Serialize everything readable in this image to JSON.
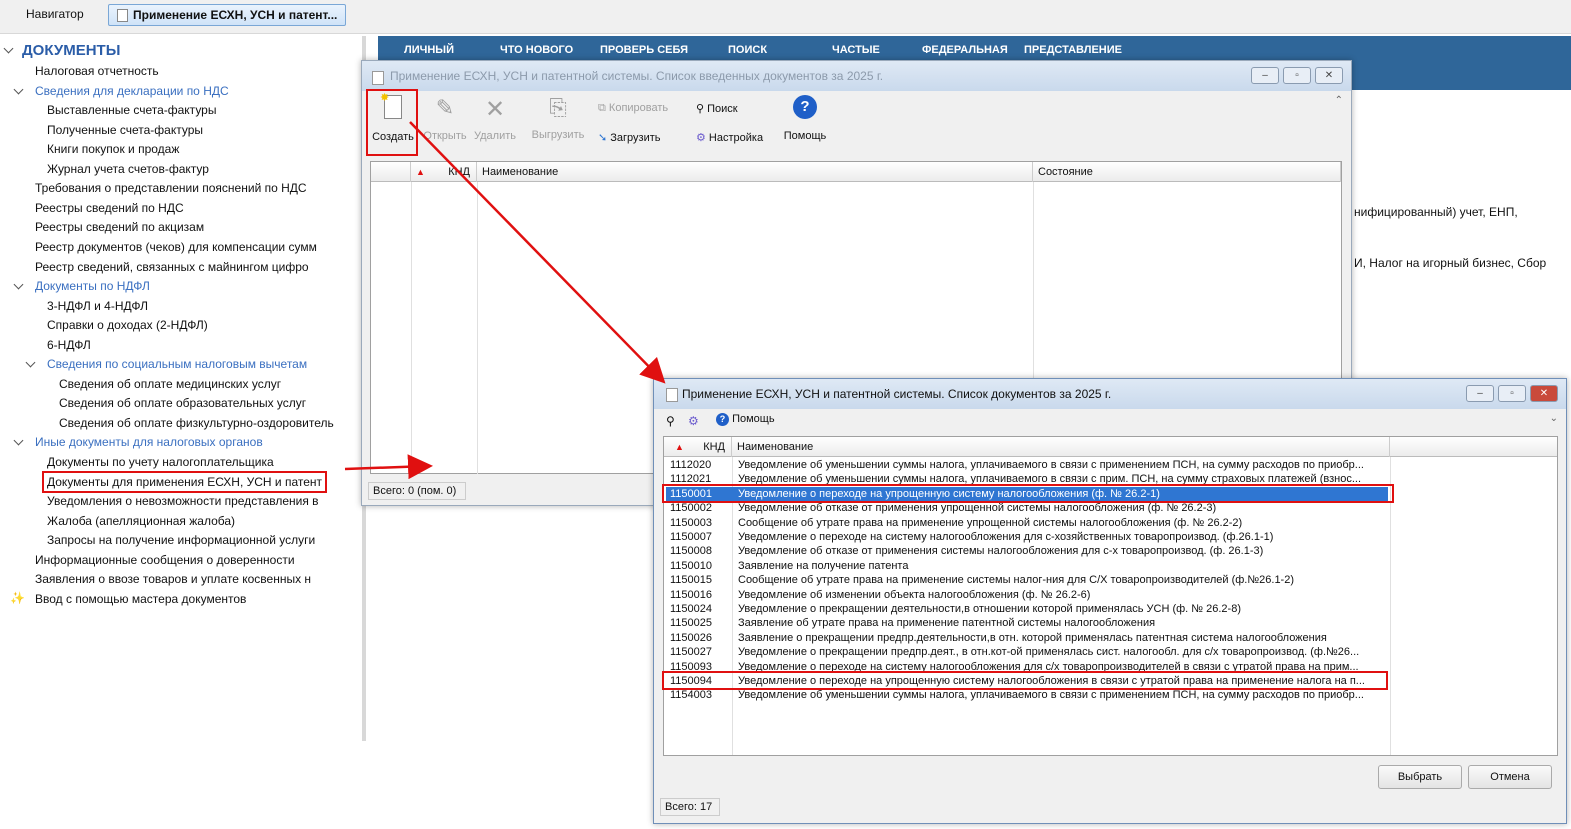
{
  "tabs": {
    "navigator": "Навигатор",
    "document": "Применение ЕСХН, УСН и патент..."
  },
  "sidebar": {
    "title": "ДОКУМЕНТЫ",
    "items": [
      {
        "label": "Налоговая отчетность",
        "level": 1
      },
      {
        "label": "Сведения для декларации по НДС",
        "level": 1,
        "group": true
      },
      {
        "label": "Выставленные счета-фактуры",
        "level": 2
      },
      {
        "label": "Полученные счета-фактуры",
        "level": 2
      },
      {
        "label": "Книги покупок и продаж",
        "level": 2
      },
      {
        "label": "Журнал учета счетов-фактур",
        "level": 2
      },
      {
        "label": "Требования о представлении пояснений по НДС",
        "level": 1
      },
      {
        "label": "Реестры сведений по НДС",
        "level": 1
      },
      {
        "label": "Реестры сведений по акцизам",
        "level": 1
      },
      {
        "label": "Реестр документов (чеков) для компенсации сумм",
        "level": 1
      },
      {
        "label": "Реестр сведений, связанных с майнингом цифро",
        "level": 1
      },
      {
        "label": "Документы по НДФЛ",
        "level": 1,
        "group": true
      },
      {
        "label": "3-НДФЛ и 4-НДФЛ",
        "level": 2
      },
      {
        "label": "Справки о доходах (2-НДФЛ)",
        "level": 2
      },
      {
        "label": "6-НДФЛ",
        "level": 2
      },
      {
        "label": "Сведения по социальным налоговым вычетам",
        "level": 2,
        "group": true
      },
      {
        "label": "Сведения об оплате медицинских услуг",
        "level": 3
      },
      {
        "label": "Сведения об оплате образовательных услуг",
        "level": 3
      },
      {
        "label": "Сведения об оплате физкультурно-оздоровитель",
        "level": 3
      },
      {
        "label": "Иные документы для налоговых органов",
        "level": 1,
        "group": true
      },
      {
        "label": "Документы по учету налогоплательщика",
        "level": 2
      },
      {
        "label": "Документы для применения ЕСХН, УСН и патент",
        "level": 2,
        "highlighted": true
      },
      {
        "label": "Уведомления о невозможности представления в",
        "level": 2
      },
      {
        "label": "Жалоба (апелляционная жалоба)",
        "level": 2
      },
      {
        "label": "Запросы на получение информационной услуги",
        "level": 2
      },
      {
        "label": "Информационные сообщения о доверенности",
        "level": 1
      },
      {
        "label": "Заявления о ввозе товаров и уплате косвенных н",
        "level": 1
      },
      {
        "label": "Ввод с помощью мастера документов",
        "level": 1,
        "wizard": true
      }
    ]
  },
  "topnav": [
    "ЛИЧНЫЙ",
    "ЧТО НОВОГО",
    "ПРОВЕРЬ СЕБЯ",
    "ПОИСК",
    "ЧАСТЫЕ",
    "ФЕДЕРАЛЬНАЯ",
    "ПРЕДСТАВЛЕНИЕ"
  ],
  "background_text": [
    "нифицированный) учет, ЕНП,",
    "И, Налог на игорный бизнес, Сбор"
  ],
  "window1": {
    "title": "Применение ЕСХН, УСН и патентной системы. Список введенных документов за 2025 г.",
    "toolbar": {
      "create": "Создать",
      "open": "Открыть",
      "delete": "Удалить",
      "export": "Выгрузить",
      "copy": "Копировать",
      "load": "Загрузить",
      "search": "Поиск",
      "settings": "Настройка",
      "help": "Помощь"
    },
    "columns": {
      "knd": "КНД",
      "name": "Наименование",
      "state": "Состояние"
    },
    "status": "Всего: 0 (пом. 0)"
  },
  "window2": {
    "title": "Применение ЕСХН, УСН и патентной системы. Список документов за 2025 г.",
    "help": "Помощь",
    "columns": {
      "knd": "КНД",
      "name": "Наименование"
    },
    "rows": [
      {
        "knd": "1112020",
        "name": "Уведомление об уменьшении суммы налога, уплачиваемого в связи с применением ПСН, на сумму расходов по приобр..."
      },
      {
        "knd": "1112021",
        "name": "Уведомление об уменьшении суммы налога, уплачиваемого в связи с прим. ПСН, на сумму страховых платежей (взнос..."
      },
      {
        "knd": "1150001",
        "name": "Уведомление о переходе на упрощенную систему налогообложения (ф. № 26.2-1)",
        "selected": true
      },
      {
        "knd": "1150002",
        "name": "Уведомление об отказе от применения упрощенной системы налогообложения (ф. № 26.2-3)"
      },
      {
        "knd": "1150003",
        "name": "Сообщение об утрате права на применение упрощенной системы налогообложения (ф. № 26.2-2)"
      },
      {
        "knd": "1150007",
        "name": "Уведомление  о переходе на систему налогообложения  для с-хозяйственных товаропроизвод. (ф.26.1-1)"
      },
      {
        "knd": "1150008",
        "name": "Уведомление об отказе от применения системы налогообложения для с-х товаропроизвод. (ф. 26.1-3)"
      },
      {
        "knd": "1150010",
        "name": "Заявление на получение патента"
      },
      {
        "knd": "1150015",
        "name": "Сообщение об утрате права на применение системы налог-ния для С/Х товаропроизводителей (ф.№26.1-2)"
      },
      {
        "knd": "1150016",
        "name": "Уведомление об изменении объекта налогообложения (ф. № 26.2-6)"
      },
      {
        "knd": "1150024",
        "name": "Уведомление о прекращении деятельности,в отношении которой применялась УСН (ф. № 26.2-8)"
      },
      {
        "knd": "1150025",
        "name": "Заявление об утрате права на применение патентной системы налогообложения"
      },
      {
        "knd": "1150026",
        "name": "Заявление о прекращении предпр.деятельности,в отн. которой применялась патентная система налогообложения"
      },
      {
        "knd": "1150027",
        "name": "Уведомление о прекращении предпр.деят., в отн.кот-ой применялась сист. налогообл. для с/х товаропроизвод. (ф.№26..."
      },
      {
        "knd": "1150093",
        "name": "Уведомление о переходе на систему налогообложения для с/х товаропроизводителей в связи с утратой права на прим..."
      },
      {
        "knd": "1150094",
        "name": "Уведомление о переходе на упрощенную систему налогообложения в связи с утратой права на применение налога на п...",
        "highlighted": true
      },
      {
        "knd": "1154003",
        "name": "Уведомление об уменьшении суммы налога, уплачиваемого в связи с применением ПСН, на сумму расходов по приобр..."
      }
    ],
    "select": "Выбрать",
    "cancel": "Отмена",
    "status": "Всего: 17"
  }
}
